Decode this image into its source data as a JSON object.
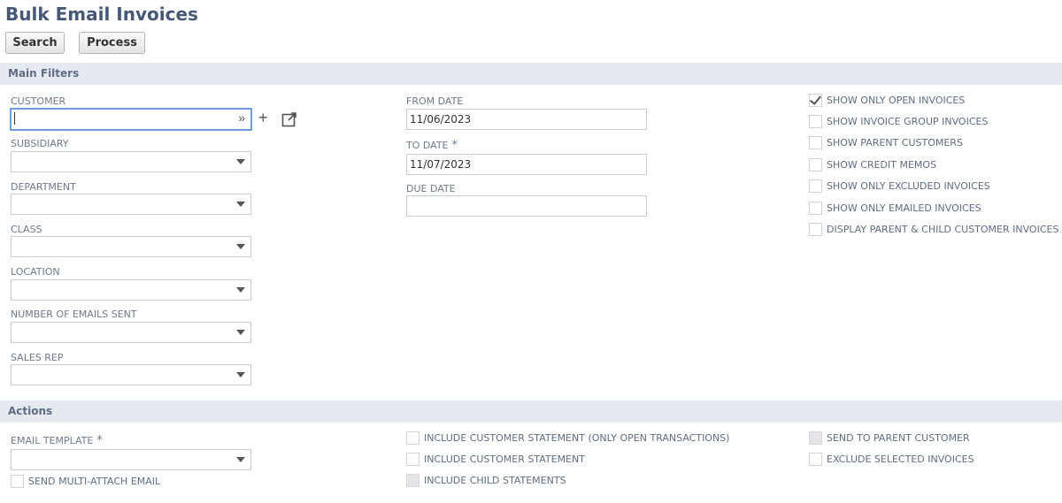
{
  "page": {
    "title": "Bulk Email Invoices"
  },
  "toolbar": {
    "search_label": "Search",
    "process_label": "Process"
  },
  "main_filters": {
    "header": "Main Filters",
    "customer_label": "CUSTOMER",
    "subsidiary_label": "SUBSIDIARY",
    "department_label": "DEPARTMENT",
    "class_label": "CLASS",
    "location_label": "LOCATION",
    "emails_sent_label": "NUMBER OF EMAILS SENT",
    "sales_rep_label": "SALES REP",
    "from_date_label": "FROM DATE",
    "from_date_value": "11/06/2023",
    "to_date_label": "TO DATE",
    "to_date_value": "11/07/2023",
    "due_date_label": "DUE DATE",
    "due_date_value": "",
    "required_marker": "*",
    "checkboxes": [
      {
        "label": "SHOW ONLY OPEN INVOICES",
        "checked": true
      },
      {
        "label": "SHOW INVOICE GROUP INVOICES",
        "checked": false
      },
      {
        "label": "SHOW PARENT CUSTOMERS",
        "checked": false
      },
      {
        "label": "SHOW CREDIT MEMOS",
        "checked": false
      },
      {
        "label": "SHOW ONLY EXCLUDED INVOICES",
        "checked": false
      },
      {
        "label": "SHOW ONLY EMAILED INVOICES",
        "checked": false
      },
      {
        "label": "DISPLAY PARENT & CHILD CUSTOMER INVOICES",
        "checked": false
      }
    ]
  },
  "actions": {
    "header": "Actions",
    "email_template_label": "EMAIL TEMPLATE",
    "required_marker": "*",
    "send_multi_attach": "SEND MULTI-ATTACH EMAIL",
    "include_statement_open": "INCLUDE CUSTOMER STATEMENT (ONLY OPEN TRANSACTIONS)",
    "include_statement": "INCLUDE CUSTOMER STATEMENT",
    "include_child": "INCLUDE CHILD STATEMENTS",
    "send_parent": "SEND TO PARENT CUSTOMER",
    "exclude_selected": "EXCLUDE SELECTED INVOICES"
  },
  "icons": {
    "plus": "plus-icon",
    "open": "open-external-icon",
    "dropdown": "caret-down-icon",
    "double_chevron": "double-chevron-down-icon",
    "checkmark": "checkmark-icon"
  },
  "colors": {
    "header_bg": "#e5e9f0",
    "title": "#465876",
    "focus": "#6f9fd8"
  }
}
